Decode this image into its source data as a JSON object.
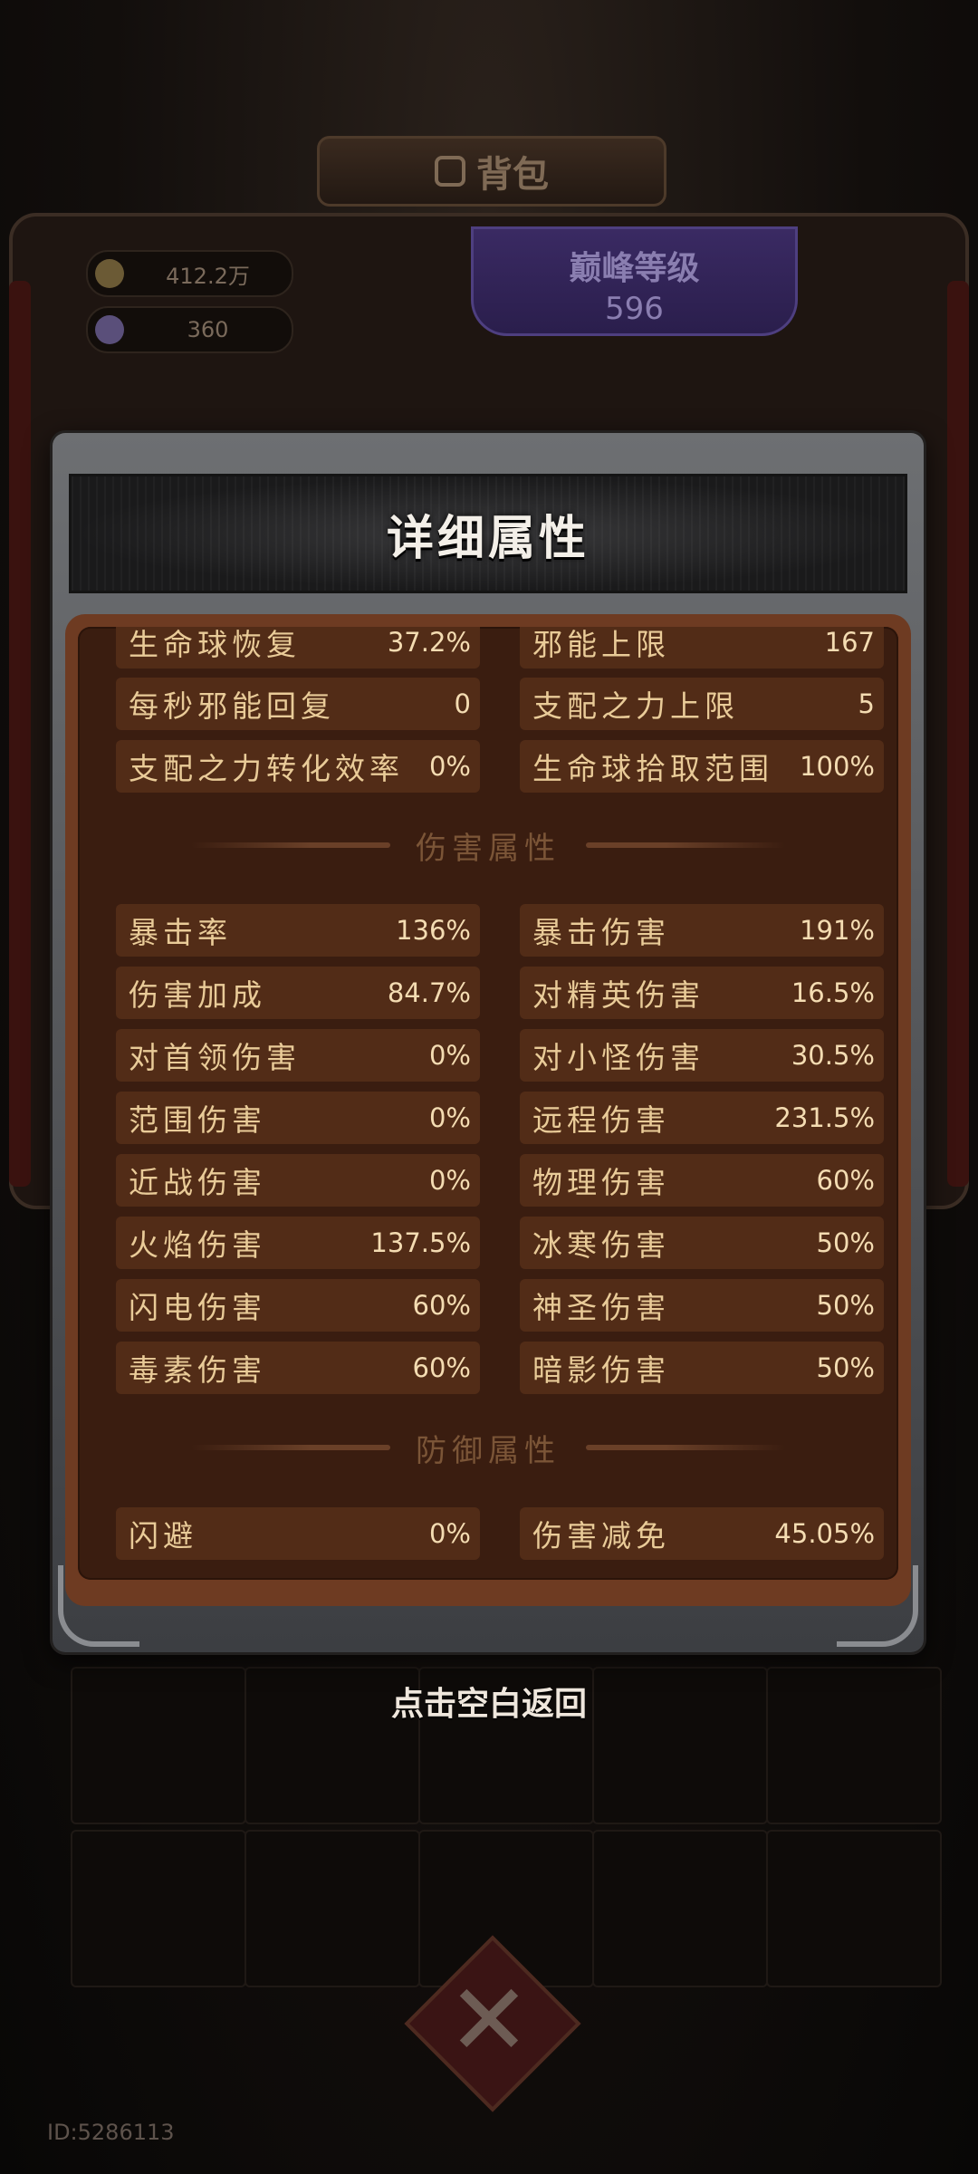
{
  "background": {
    "title": "背包",
    "currency": [
      {
        "icon": "gold-coin-icon",
        "value": "412.2万"
      },
      {
        "icon": "diamond-icon",
        "value": "360"
      }
    ],
    "level": {
      "label": "巅峰等级",
      "value": "596"
    },
    "player_id": "ID:5286113"
  },
  "panel": {
    "title": "详细属性",
    "top_rows": [
      [
        {
          "label": "生命球恢复",
          "value": "37.2%"
        },
        {
          "label": "邪能上限",
          "value": "167"
        }
      ],
      [
        {
          "label": "每秒邪能回复",
          "value": "0"
        },
        {
          "label": "支配之力上限",
          "value": "5"
        }
      ],
      [
        {
          "label": "支配之力转化效率",
          "value": "0%"
        },
        {
          "label": "生命球拾取范围",
          "value": "100%"
        }
      ]
    ],
    "damage_section": {
      "title": "伤害属性",
      "rows": [
        [
          {
            "label": "暴击率",
            "value": "136%"
          },
          {
            "label": "暴击伤害",
            "value": "191%"
          }
        ],
        [
          {
            "label": "伤害加成",
            "value": "84.7%"
          },
          {
            "label": "对精英伤害",
            "value": "16.5%"
          }
        ],
        [
          {
            "label": "对首领伤害",
            "value": "0%"
          },
          {
            "label": "对小怪伤害",
            "value": "30.5%"
          }
        ],
        [
          {
            "label": "范围伤害",
            "value": "0%"
          },
          {
            "label": "远程伤害",
            "value": "231.5%"
          }
        ],
        [
          {
            "label": "近战伤害",
            "value": "0%"
          },
          {
            "label": "物理伤害",
            "value": "60%"
          }
        ],
        [
          {
            "label": "火焰伤害",
            "value": "137.5%"
          },
          {
            "label": "冰寒伤害",
            "value": "50%"
          }
        ],
        [
          {
            "label": "闪电伤害",
            "value": "60%"
          },
          {
            "label": "神圣伤害",
            "value": "50%"
          }
        ],
        [
          {
            "label": "毒素伤害",
            "value": "60%"
          },
          {
            "label": "暗影伤害",
            "value": "50%"
          }
        ]
      ]
    },
    "defense_section": {
      "title": "防御属性",
      "rows": [
        [
          {
            "label": "闪避",
            "value": "0%"
          },
          {
            "label": "伤害减免",
            "value": "45.05%"
          }
        ]
      ]
    }
  },
  "hint": "点击空白返回",
  "colors": {
    "panel_brown": "#3a1d10",
    "cell_brown": "#522c17",
    "label_gold": "#e9cb98"
  }
}
